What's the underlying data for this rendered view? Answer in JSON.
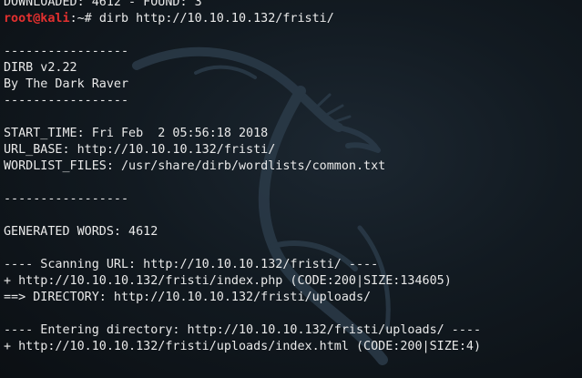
{
  "terminal": {
    "background_color": "#121a21",
    "text_color": "#e9e9e9",
    "prompt_color": "#e3302f",
    "prompt_user": "root@kali",
    "prompt_suffix": ":~# ",
    "command": "dirb http://10.10.10.132/fristi/",
    "lines_before": [
      "DOWNLOADED: 4612 - FOUND: 3"
    ],
    "lines_after": [
      "",
      "-----------------",
      "DIRB v2.22",
      "By The Dark Raver",
      "-----------------",
      "",
      "START_TIME: Fri Feb  2 05:56:18 2018",
      "URL_BASE: http://10.10.10.132/fristi/",
      "WORDLIST_FILES: /usr/share/dirb/wordlists/common.txt",
      "",
      "-----------------",
      "",
      "GENERATED WORDS: 4612",
      "",
      "---- Scanning URL: http://10.10.10.132/fristi/ ----",
      "+ http://10.10.10.132/fristi/index.php (CODE:200|SIZE:134605)",
      "==> DIRECTORY: http://10.10.10.132/fristi/uploads/",
      "",
      "---- Entering directory: http://10.10.10.132/fristi/uploads/ ----",
      "+ http://10.10.10.132/fristi/uploads/index.html (CODE:200|SIZE:4)"
    ]
  },
  "background_icon": "kali-dragon-icon"
}
